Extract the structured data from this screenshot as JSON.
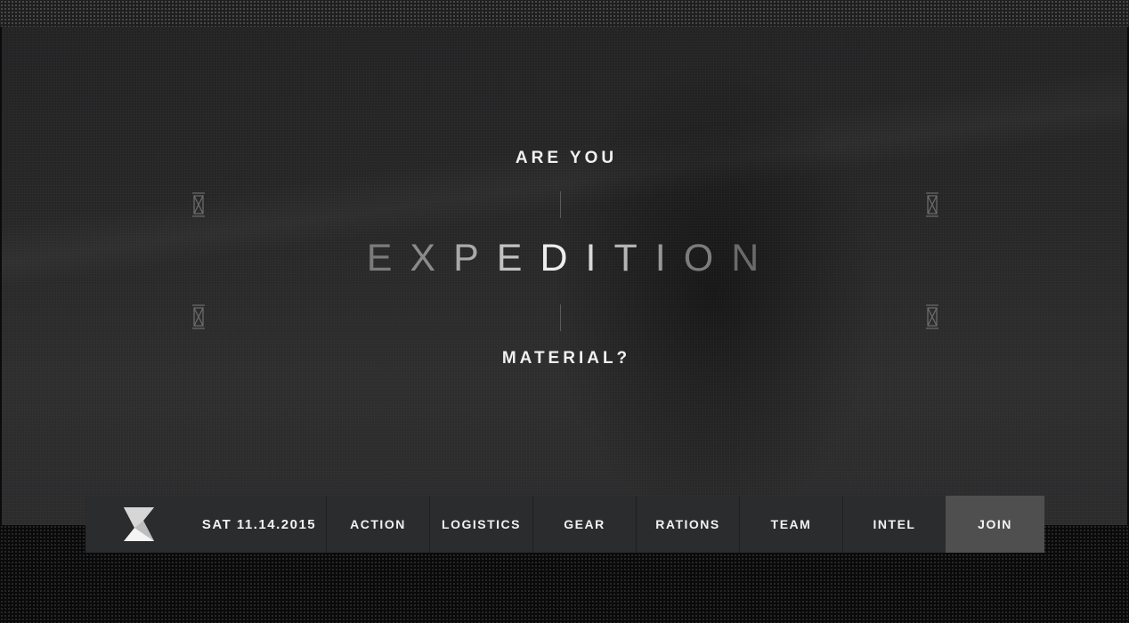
{
  "hero": {
    "line1": "ARE YOU",
    "letters": [
      "E",
      "X",
      "P",
      "E",
      "D",
      "I",
      "T",
      "I",
      "O",
      "N"
    ],
    "line3": "MATERIAL?"
  },
  "nav": {
    "date": "SAT 11.14.2015",
    "items": [
      {
        "label": "ACTION"
      },
      {
        "label": "LOGISTICS"
      },
      {
        "label": "GEAR"
      },
      {
        "label": "RATIONS"
      },
      {
        "label": "TEAM"
      },
      {
        "label": "INTEL"
      }
    ],
    "join": "JOIN"
  },
  "colors": {
    "navbar": "#2b2c2e",
    "join_bg": "#4f4f50",
    "text": "#f1f1f1"
  },
  "icons": {
    "logo": "hourglass-logo-icon",
    "corner_markers": "crossed-box-icon"
  }
}
